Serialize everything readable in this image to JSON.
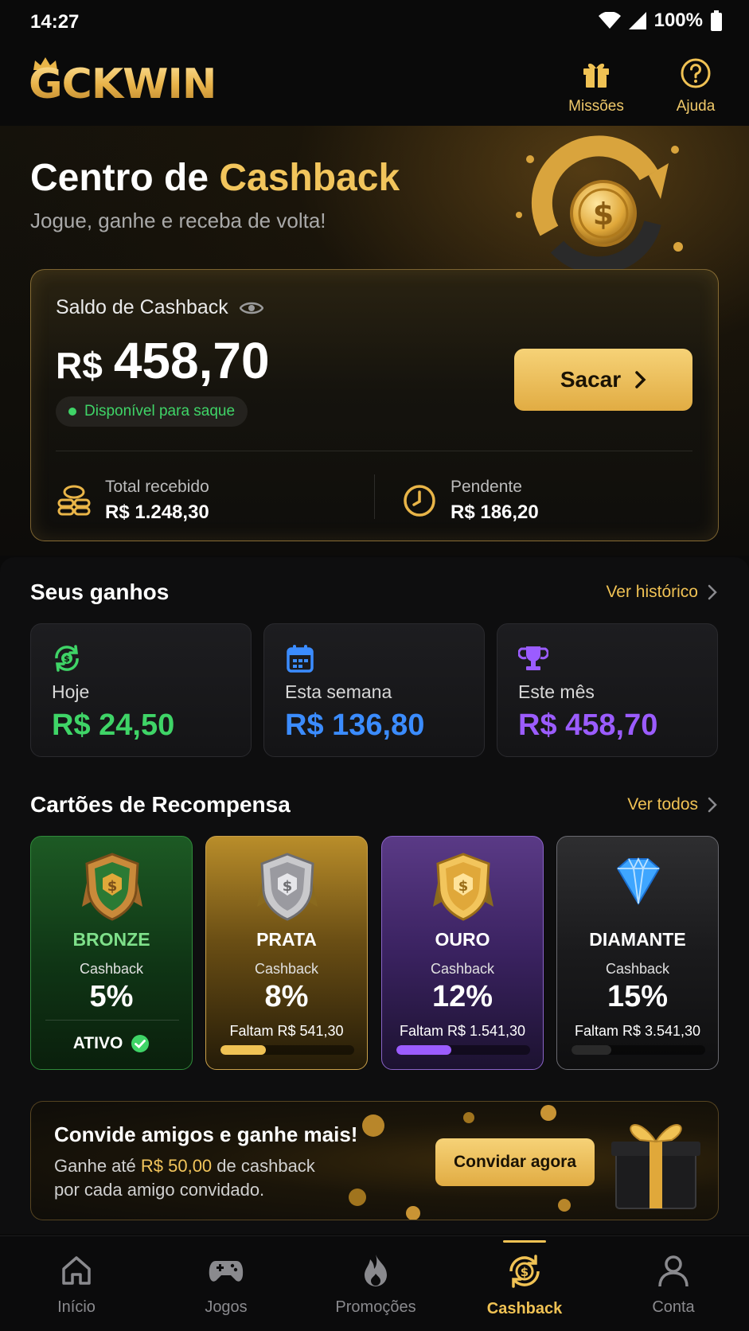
{
  "status_bar": {
    "time": "14:27",
    "battery": "100%"
  },
  "header": {
    "logo": "GCKWIN",
    "missions_label": "Missões",
    "help_label": "Ajuda"
  },
  "hero": {
    "title_part1": "Centro de ",
    "title_part2": "Cashback",
    "subtitle": "Jogue, ganhe e receba de volta!"
  },
  "balance": {
    "label": "Saldo de Cashback",
    "currency": "R$",
    "amount": "458,70",
    "status": "Disponível para saque",
    "withdraw_label": "Sacar",
    "total_label": "Total recebido",
    "total_value": "R$ 1.248,30",
    "pending_label": "Pendente",
    "pending_value": "R$ 186,20"
  },
  "earnings": {
    "title": "Seus ganhos",
    "link": "Ver histórico",
    "items": [
      {
        "label": "Hoje",
        "value": "R$ 24,50",
        "color": "#3fd467",
        "icon": "cash-refresh-icon"
      },
      {
        "label": "Esta semana",
        "value": "R$ 136,80",
        "color": "#3b8cff",
        "icon": "calendar-icon"
      },
      {
        "label": "Este mês",
        "value": "R$ 458,70",
        "color": "#9b5cff",
        "icon": "trophy-icon"
      }
    ]
  },
  "rewards": {
    "title": "Cartões de Recompensa",
    "link": "Ver todos",
    "cashback_label": "Cashback",
    "tiers": [
      {
        "name": "BRONZE",
        "pct": "5%",
        "status": "ATIVO",
        "name_color": "#7ee08a"
      },
      {
        "name": "PRATA",
        "pct": "8%",
        "need": "Faltam R$ 541,30",
        "progress": 0.34,
        "fill": "#f0c254"
      },
      {
        "name": "OURO",
        "pct": "12%",
        "need": "Faltam R$ 1.541,30",
        "progress": 0.41,
        "fill": "#9b5cff"
      },
      {
        "name": "DIAMANTE",
        "pct": "15%",
        "need": "Faltam R$ 3.541,30",
        "progress": 0.3,
        "fill": "#2a2a2a"
      }
    ]
  },
  "invite": {
    "title": "Convide amigos e ganhe mais!",
    "sub_part1": "Ganhe até ",
    "sub_amount": "R$ 50,00",
    "sub_part2": " de cashback por cada amigo convidado.",
    "button": "Convidar agora"
  },
  "nav": {
    "items": [
      {
        "label": "Início",
        "icon": "home-icon"
      },
      {
        "label": "Jogos",
        "icon": "gamepad-icon"
      },
      {
        "label": "Promoções",
        "icon": "fire-icon"
      },
      {
        "label": "Cashback",
        "icon": "cashback-icon",
        "active": true
      },
      {
        "label": "Conta",
        "icon": "user-icon"
      }
    ]
  }
}
